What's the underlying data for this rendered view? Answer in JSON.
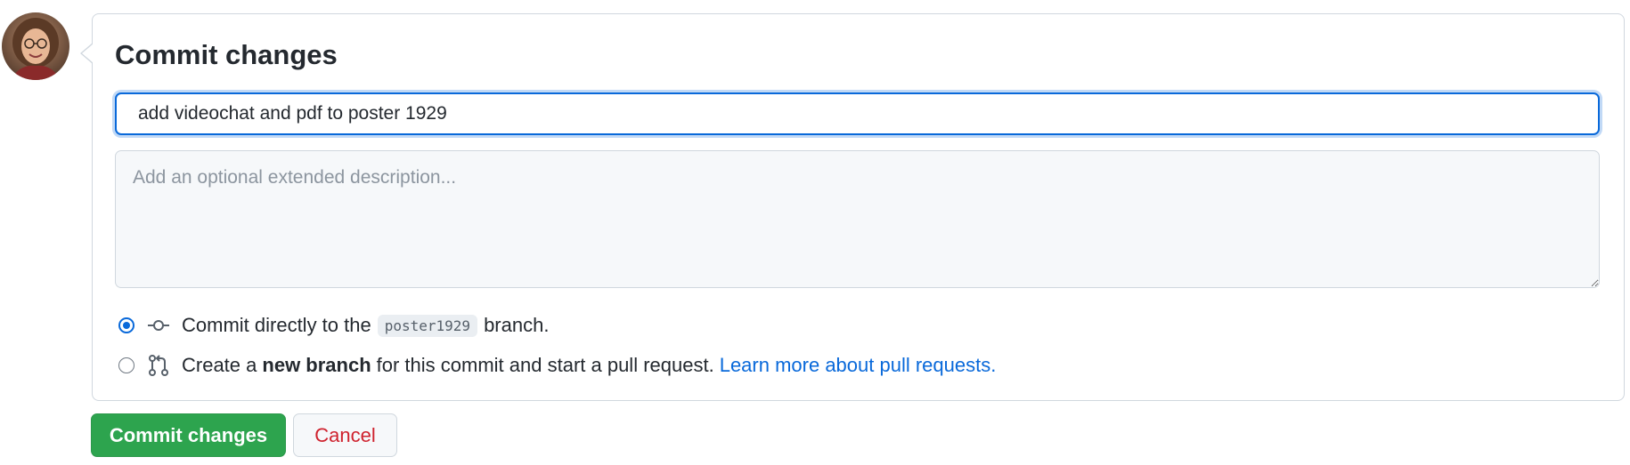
{
  "form": {
    "title": "Commit changes",
    "summary_value": "add videochat and pdf to poster 1929",
    "description_placeholder": "Add an optional extended description..."
  },
  "options": {
    "direct": {
      "checked": true,
      "prefix": "Commit directly to the",
      "branch": "poster1929",
      "suffix": "branch."
    },
    "new_branch": {
      "checked": false,
      "prefix": "Create a",
      "bold": "new branch",
      "suffix": "for this commit and start a pull request.",
      "link": "Learn more about pull requests."
    }
  },
  "buttons": {
    "commit_label": "Commit changes",
    "cancel_label": "Cancel"
  },
  "icons": {
    "avatar": "user-avatar",
    "commit": "git-commit-icon",
    "pull_request": "git-pull-request-icon"
  },
  "colors": {
    "primary_green": "#2da44e",
    "focus_blue": "#0969da",
    "cancel_red": "#cf222e",
    "link_blue": "#0969da"
  }
}
